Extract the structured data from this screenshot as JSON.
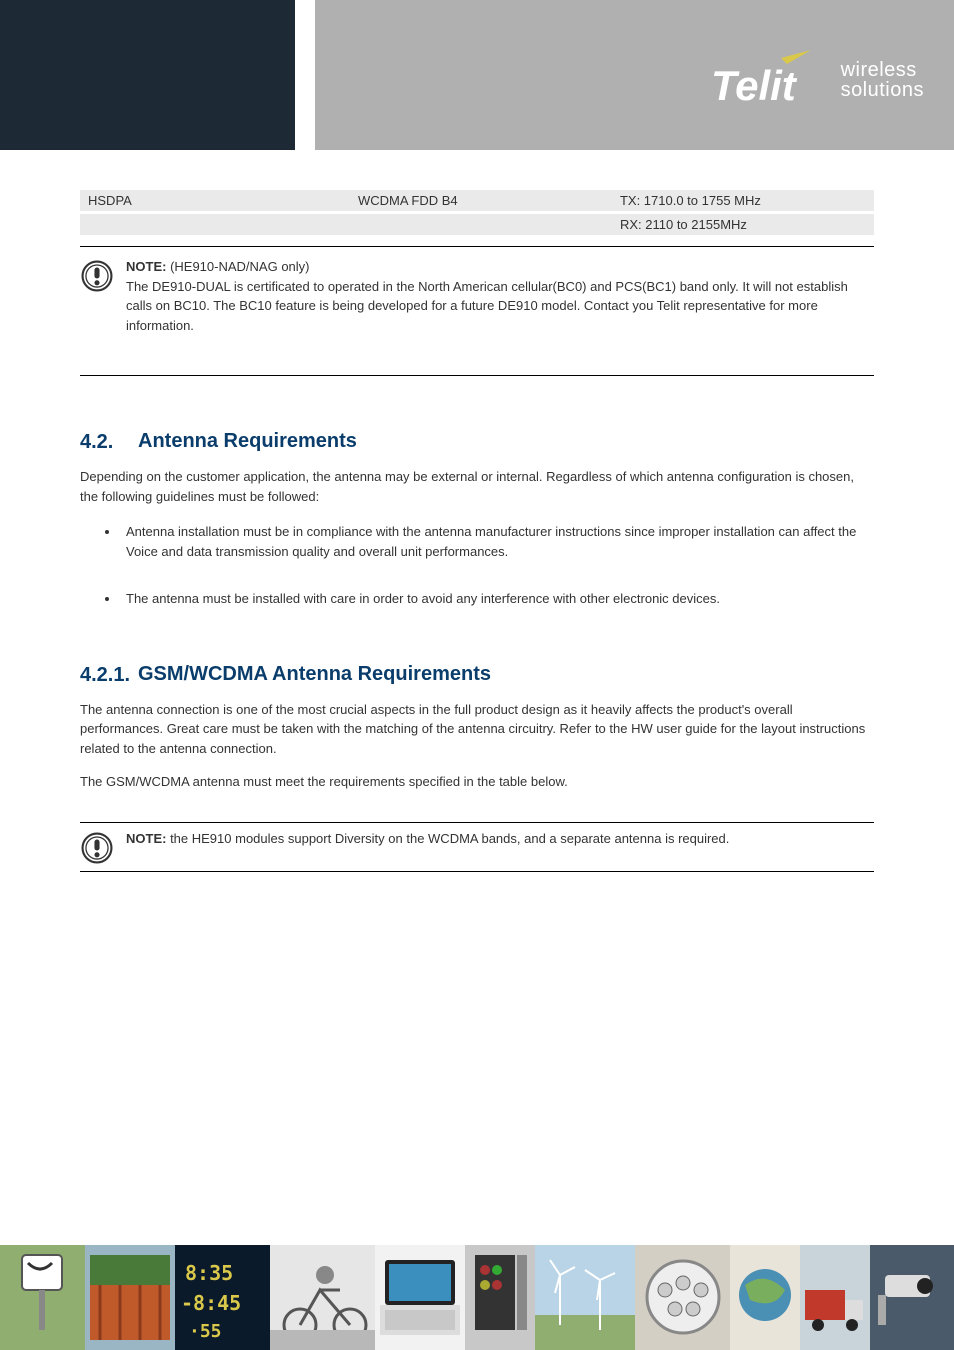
{
  "logo": {
    "word": "Telit",
    "line1": "wireless",
    "line2": "solutions"
  },
  "table": {
    "row1": {
      "c1": "HSDPA",
      "c2": "WCDMA FDD B4",
      "c3": "TX: 1710.0 to 1755 MHz"
    },
    "row2": {
      "c1": "",
      "c2": "",
      "c3": "RX: 2110 to 2155MHz"
    }
  },
  "note1": {
    "label": "NOTE:",
    "text": " (HE910-NAD/NAG only)\nThe DE910-DUAL is certificated to operated in the North American cellular(BC0) and PCS(BC1) band only. It will not establish calls on BC10. The BC10 feature is being developed for a future DE910 model. Contact you Telit representative for more information."
  },
  "section": {
    "number": "4.2.",
    "title": "Antenna Requirements",
    "para": "Depending on the customer application, the antenna may be external or internal.  Regardless of which antenna configuration is chosen, the following guidelines must be followed:",
    "bullets": [
      "Antenna installation must be in compliance with the antenna manufacturer instructions since improper installation can affect the Voice and data transmission quality and overall unit performances.",
      "The antenna must be installed with care in order to avoid any interference with other electronic devices."
    ]
  },
  "subsection": {
    "number": "4.2.1.",
    "title": "GSM/WCDMA Antenna Requirements",
    "para": "The antenna connection is one of the most crucial aspects in the full product design as it heavily affects the product's overall performances. Great care must be taken with the matching of the antenna circuitry. Refer to the HW user guide for the layout instructions related to the antenna connection.",
    "para2": "The GSM/WCDMA antenna must meet the requirements specified in the table below."
  },
  "note2": {
    "label": "NOTE:",
    "text": " the HE910 modules support Diversity on the WCDMA bands, and a separate antenna is required."
  }
}
